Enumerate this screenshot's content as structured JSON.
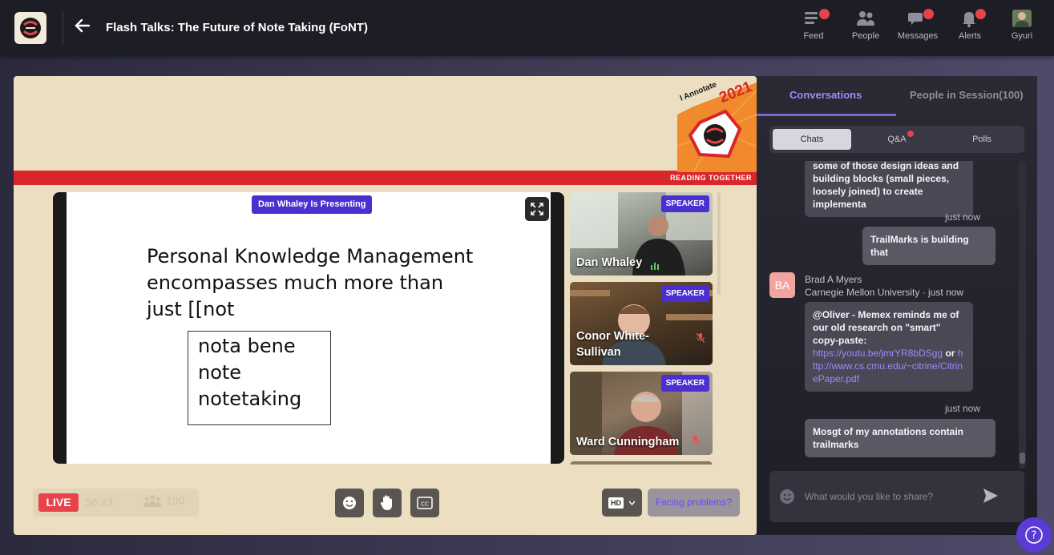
{
  "header": {
    "title": "Flash Talks: The Future of Note Taking (FoNT)",
    "nav": [
      {
        "label": "Feed",
        "icon": "feed-icon",
        "badge": true
      },
      {
        "label": "People",
        "icon": "people-icon",
        "badge": false
      },
      {
        "label": "Messages",
        "icon": "messages-icon",
        "badge": true
      },
      {
        "label": "Alerts",
        "icon": "bell-icon",
        "badge": true
      },
      {
        "label": "Gyuri",
        "icon": "user-avatar",
        "badge": false
      }
    ]
  },
  "banner": {
    "badge_top": "I Annotate",
    "badge_year": "2021",
    "tagline": "READING TOGETHER"
  },
  "slide": {
    "presenting_label": "Dan Whaley Is Presenting",
    "lines": [
      "Personal Knowledge Management",
      "encompasses much more than",
      "just [[not"
    ],
    "box_lines": [
      "nota bene",
      "note",
      "notetaking"
    ]
  },
  "speakers": [
    {
      "name": "Dan Whaley",
      "tag": "SPEAKER",
      "muted": false
    },
    {
      "name": "Conor White-Sullivan",
      "tag": "SPEAKER",
      "muted": true
    },
    {
      "name": "Ward Cunningham",
      "tag": "SPEAKER",
      "muted": true
    }
  ],
  "controls": {
    "live": "LIVE",
    "timer": "56:23",
    "attendees": "100",
    "quality": "HD",
    "facing": "Facing problems?"
  },
  "panel": {
    "tab_conversations": "Conversations",
    "tab_people": "People in Session(100)",
    "seg_chats": "Chats",
    "seg_qa": "Q&A",
    "seg_polls": "Polls",
    "messages": {
      "m1": "some of those design ideas and building blocks (small pieces, loosely joined) to create implementa",
      "ts1": "just now",
      "m2": "TrailMarks is building that",
      "avatar_initials": "BA",
      "author_name": "Brad A Myers",
      "author_meta": "Carnegie Mellon University · just now",
      "m3_text": "@Oliver - Memex reminds me of our old research on \"smart\" copy-paste:",
      "m3_link1": "https://youtu.be/jmrYR8bDSgg",
      "m3_or": "or",
      "m3_link2": "http://www.cs.cmu.edu/~citrine/CitrinePaper.pdf",
      "ts2": "just now",
      "m4": "Mosgt of my annotations contain trailmarks"
    },
    "input_placeholder": "What would you like to share?"
  },
  "colors": {
    "accent": "#4b2fd0",
    "live": "#e8424b",
    "stage_bg": "#ecdfc1",
    "red_band": "#d9262b"
  }
}
